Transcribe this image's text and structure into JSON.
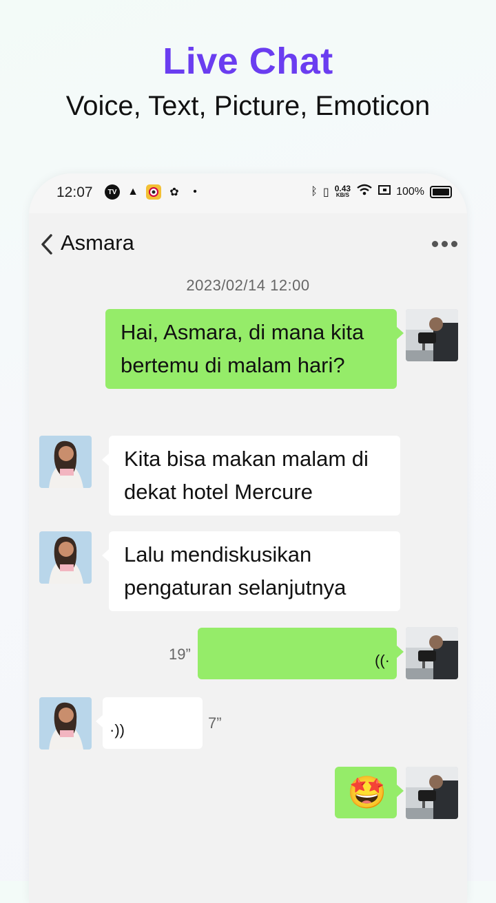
{
  "hero": {
    "title": "Live Chat",
    "subtitle": "Voice, Text, Picture, Emoticon"
  },
  "status_bar": {
    "time": "12:07",
    "network_speed": "0.43",
    "network_unit": "KB/S",
    "battery": "100%",
    "icons": [
      "tv-icon",
      "warning-icon",
      "camera-app-icon",
      "app-icon",
      "dot-icon",
      "bluetooth-icon",
      "vibrate-icon",
      "wifi-icon",
      "screen-icon",
      "battery-icon"
    ]
  },
  "chat": {
    "contact_name": "Asmara",
    "timestamp": "2023/02/14  12:00",
    "messages": [
      {
        "from": "me",
        "type": "text",
        "text": "Hai, Asmara, di mana kita bertemu di malam hari?"
      },
      {
        "from": "them",
        "type": "text",
        "text": "Kita bisa makan malam di dekat hotel Mercure"
      },
      {
        "from": "them",
        "type": "text",
        "text": "Lalu mendiskusikan pengaturan selanjutnya"
      },
      {
        "from": "me",
        "type": "voice",
        "duration": "19”"
      },
      {
        "from": "them",
        "type": "voice",
        "duration": "7”"
      },
      {
        "from": "me",
        "type": "emoji",
        "text": "🤩"
      }
    ]
  },
  "colors": {
    "accent": "#6a3df0",
    "my_bubble": "#95ec69",
    "their_bubble": "#ffffff",
    "chat_bg": "#f2f2f2"
  }
}
